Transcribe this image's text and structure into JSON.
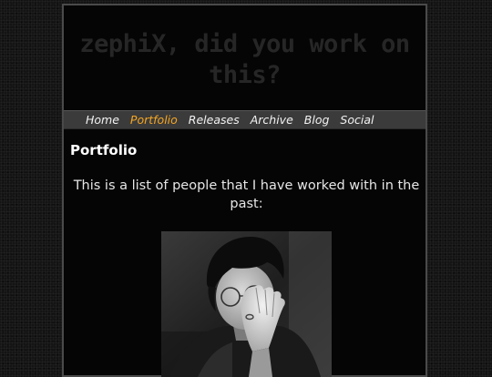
{
  "site": {
    "title": "zephiX, did you work on this?"
  },
  "nav": {
    "items": [
      {
        "label": "Home",
        "active": false
      },
      {
        "label": "Portfolio",
        "active": true
      },
      {
        "label": "Releases",
        "active": false
      },
      {
        "label": "Archive",
        "active": false
      },
      {
        "label": "Blog",
        "active": false
      },
      {
        "label": "Social",
        "active": false
      }
    ],
    "active_color": "#f5a623"
  },
  "main": {
    "heading": "Portfolio",
    "intro": "This is a list of people that I have worked with in the past:"
  }
}
